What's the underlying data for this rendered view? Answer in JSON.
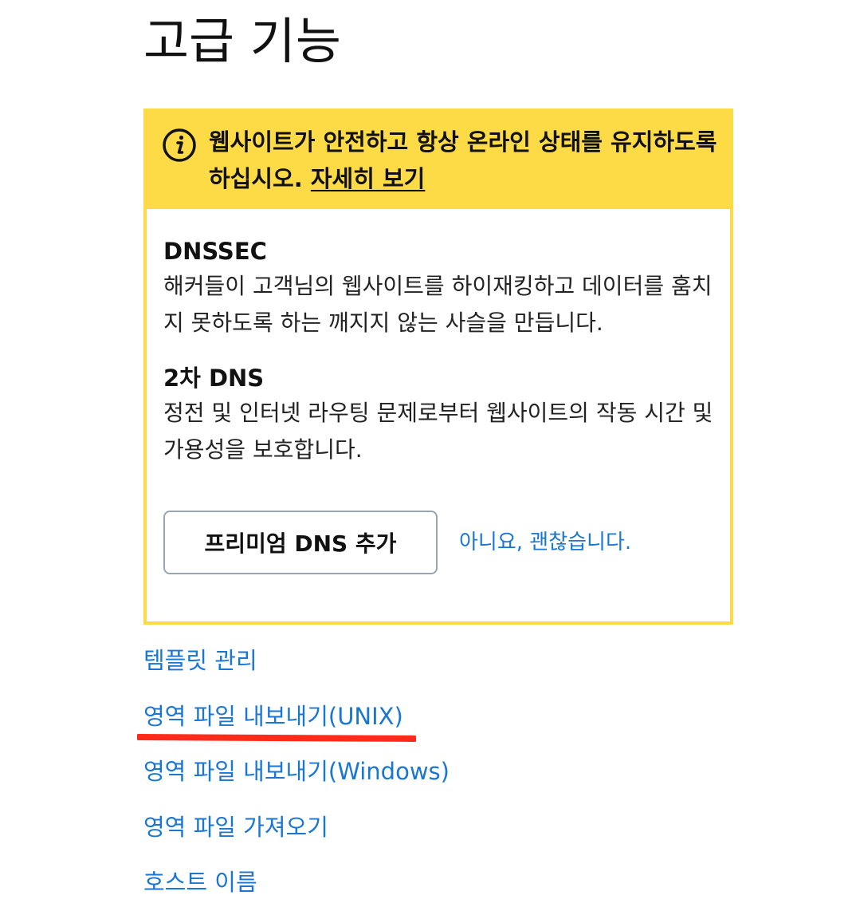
{
  "page": {
    "title": "고급 기능"
  },
  "promo": {
    "banner_text": "웹사이트가 안전하고 항상 온라인 상태를 유지하도록 하십시오.",
    "banner_link": "자세히 보기",
    "features": [
      {
        "title": "DNSSEC",
        "description": "해커들이 고객님의 웹사이트를 하이재킹하고 데이터를 훔치지 못하도록 하는 깨지지 않는 사슬을 만듭니다."
      },
      {
        "title": "2차 DNS",
        "description": "정전 및 인터넷 라우팅 문제로부터 웹사이트의 작동 시간 및 가용성을 보호합니다."
      }
    ],
    "primary_button": "프리미엄 DNS 추가",
    "decline_link": "아니요, 괜찮습니다.",
    "accent_color": "#fddb46"
  },
  "links": [
    "템플릿 관리",
    "영역 파일 내보내기(UNIX)",
    "영역 파일 내보내기(Windows)",
    "영역 파일 가져오기",
    "호스트 이름"
  ],
  "colors": {
    "link": "#1976d2",
    "annotation": "#ff2a1a"
  }
}
